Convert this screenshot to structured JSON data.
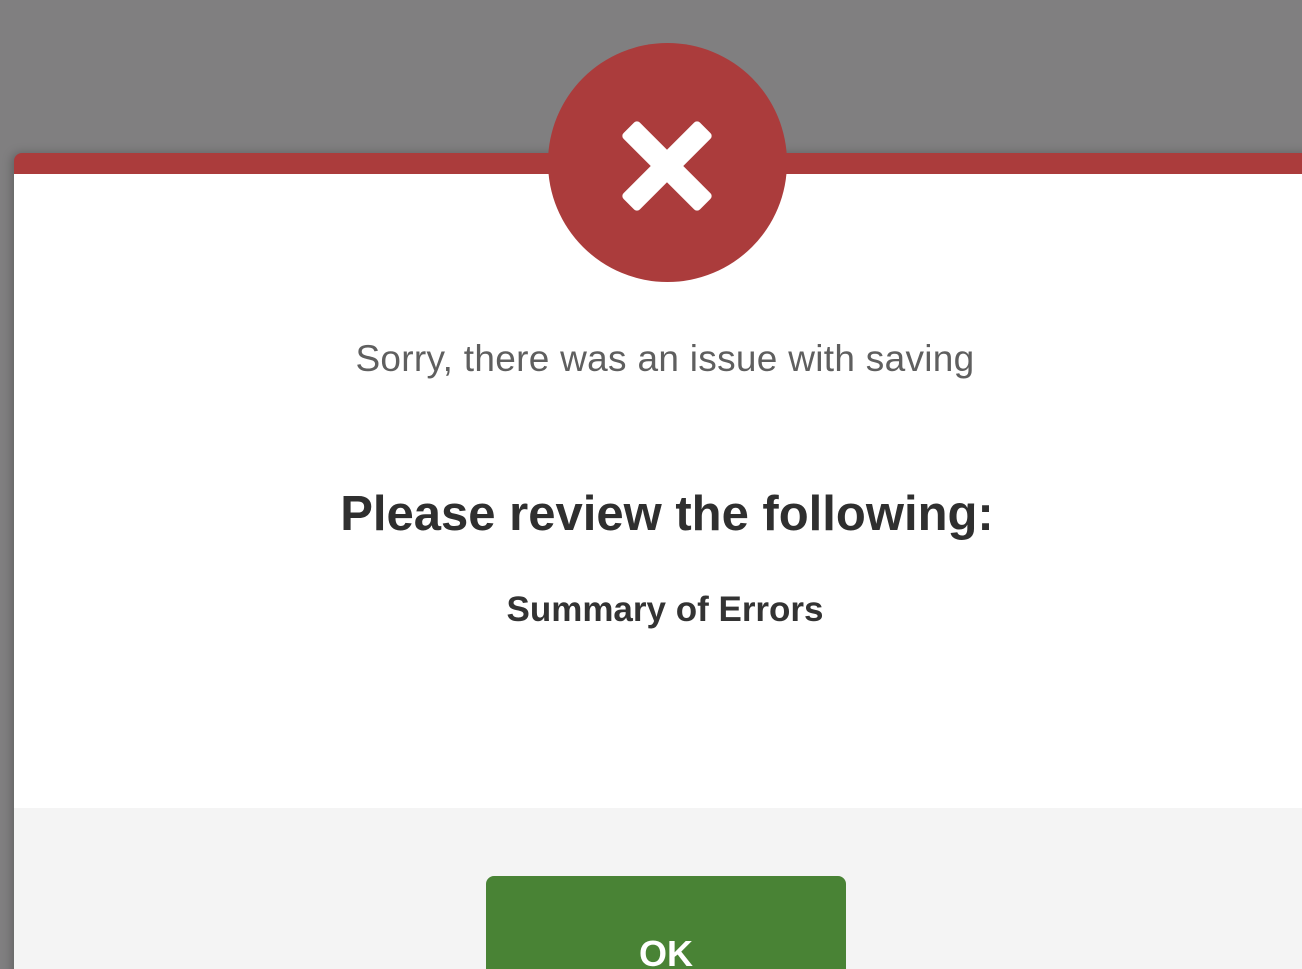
{
  "dialog": {
    "message": "Sorry, there was an issue with saving",
    "heading": "Please review the following:",
    "summary": "Summary of Errors",
    "ok_label": "OK",
    "icon": "close-x-icon"
  },
  "colors": {
    "accent_error": "#ab3c3c",
    "ok_button": "#498335",
    "overlay": "#807f80",
    "footer_bg": "#f4f4f4"
  }
}
